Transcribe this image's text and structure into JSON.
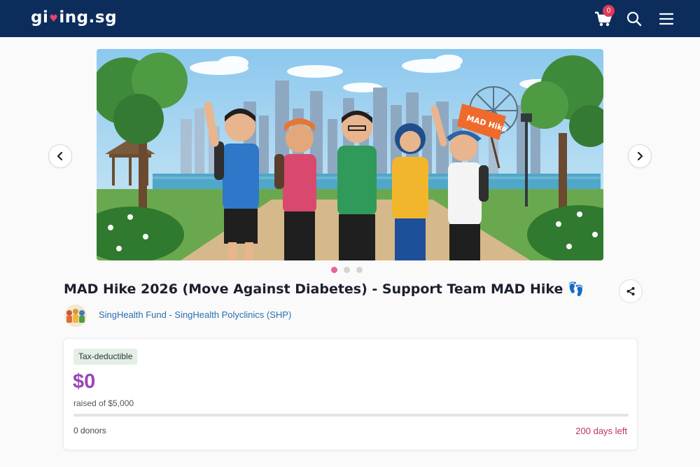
{
  "header": {
    "logo_left": "gi",
    "logo_right": "ing.sg",
    "cart_count": "0",
    "colors": {
      "bar": "#0c2d5c",
      "badge": "#e23a5a"
    }
  },
  "banner": {
    "flag_text": "MAD Hike",
    "slide_count": 3,
    "active_slide": 1
  },
  "campaign": {
    "title": "MAD Hike 2026 (Move Against Diabetes) - Support Team MAD Hike 👣",
    "organization": "SingHealth Fund - SingHealth Polyclinics (SHP)"
  },
  "stats": {
    "badge": "Tax-deductible",
    "raised": "$0",
    "raised_of": "raised of $5,000",
    "progress_fraction": 0,
    "donors": "0 donors",
    "days_left": "200 days left",
    "colors": {
      "amount": "#9a45b8",
      "days": "#c0325a"
    }
  }
}
